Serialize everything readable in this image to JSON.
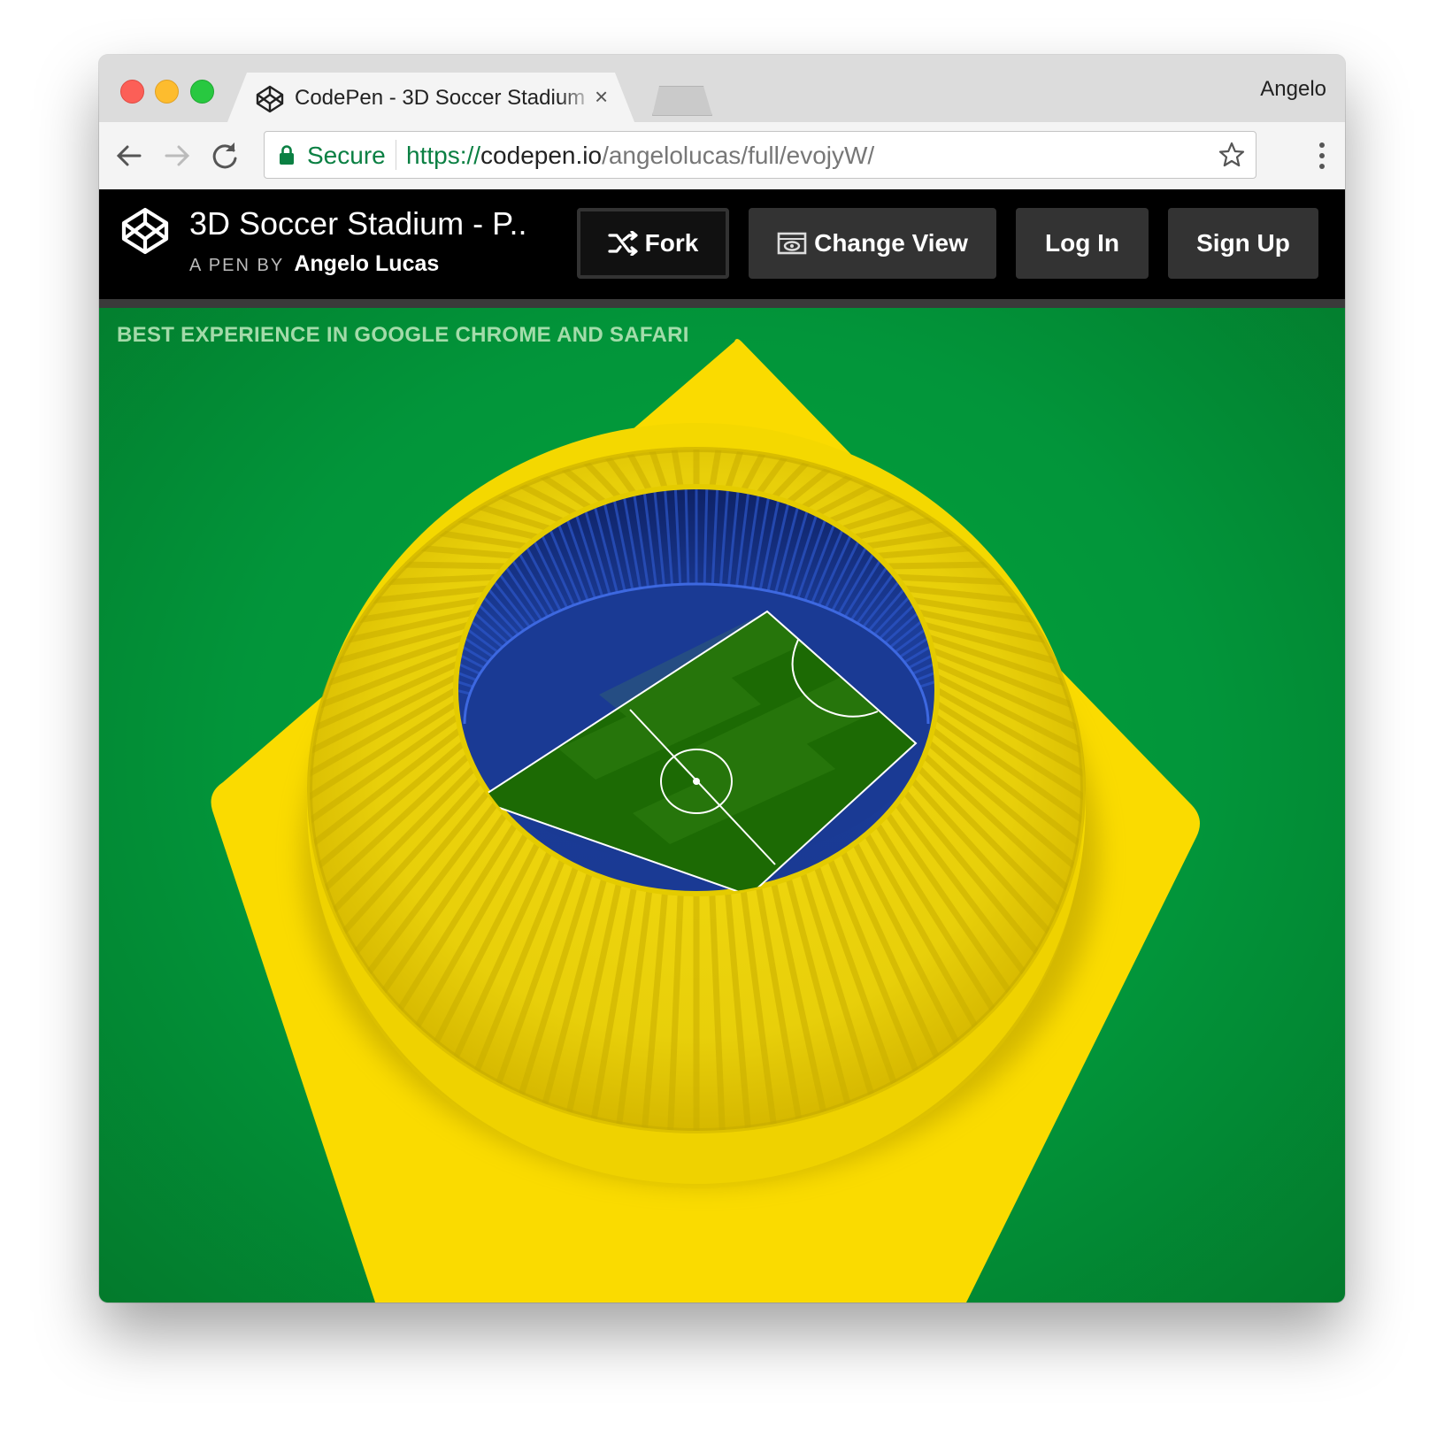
{
  "browser": {
    "tab_title": "CodePen - 3D Soccer Stadium",
    "tab_close": "×",
    "profile_name": "Angelo",
    "secure_label": "Secure",
    "url_scheme": "https://",
    "url_host": "codepen.io",
    "url_path": "/angelolucas/full/evojyW/"
  },
  "codepen": {
    "pen_title": "3D Soccer Stadium - P..",
    "byline_prefix": "A PEN BY",
    "author": "Angelo Lucas",
    "fork_label": "Fork",
    "change_view_label": "Change View",
    "login_label": "Log In",
    "signup_label": "Sign Up"
  },
  "stage": {
    "notice": "BEST EXPERIENCE IN GOOGLE CHROME AND SAFARI",
    "colors": {
      "grass_background": "#02953a",
      "flag_yellow": "#fadb00",
      "stands_blue": "#1a3a94",
      "pitch_green": "#1c6a04"
    }
  }
}
